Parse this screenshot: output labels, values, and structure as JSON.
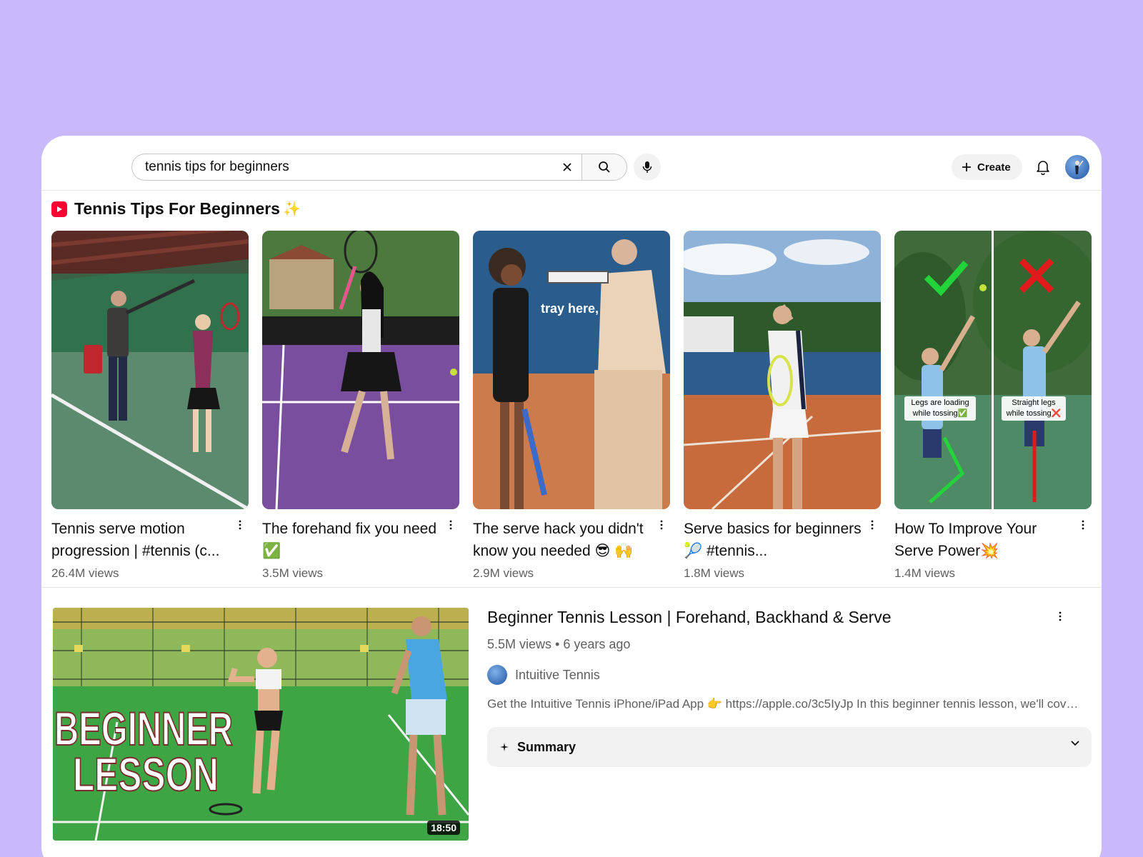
{
  "search": {
    "query": "tennis tips for beginners"
  },
  "header": {
    "create_label": "Create"
  },
  "shorts": {
    "title": "Tennis Tips For Beginners",
    "sparkle": "✨",
    "items": [
      {
        "title": "Tennis serve motion progression | #tennis (c...",
        "views": "26.4M views"
      },
      {
        "title": "The forehand fix you need ✅",
        "views": "3.5M views"
      },
      {
        "title": "The serve hack you didn't know you needed 😎 🙌",
        "views": "2.9M views",
        "overlay": "tray here,"
      },
      {
        "title": "Serve basics for beginners 🎾  #tennis...",
        "views": "1.8M views"
      },
      {
        "title": "How To Improve Your Serve Power💥",
        "views": "1.4M views",
        "overlay_left": "Legs are loading while tossing✅",
        "overlay_right": "Straight legs while tossing❌"
      }
    ]
  },
  "video": {
    "title": "Beginner Tennis Lesson | Forehand, Backhand & Serve",
    "meta": "5.5M views • 6 years ago",
    "channel": "Intuitive Tennis",
    "description": "Get the Intuitive Tennis iPhone/iPad App 👉 https://apple.co/3c5IyJp In this beginner tennis lesson, we'll cover the forehand, backhand and serve",
    "duration": "18:50",
    "thumb_text_1": "BEGINNER",
    "thumb_text_2": "LESSON",
    "summary_label": "Summary"
  }
}
